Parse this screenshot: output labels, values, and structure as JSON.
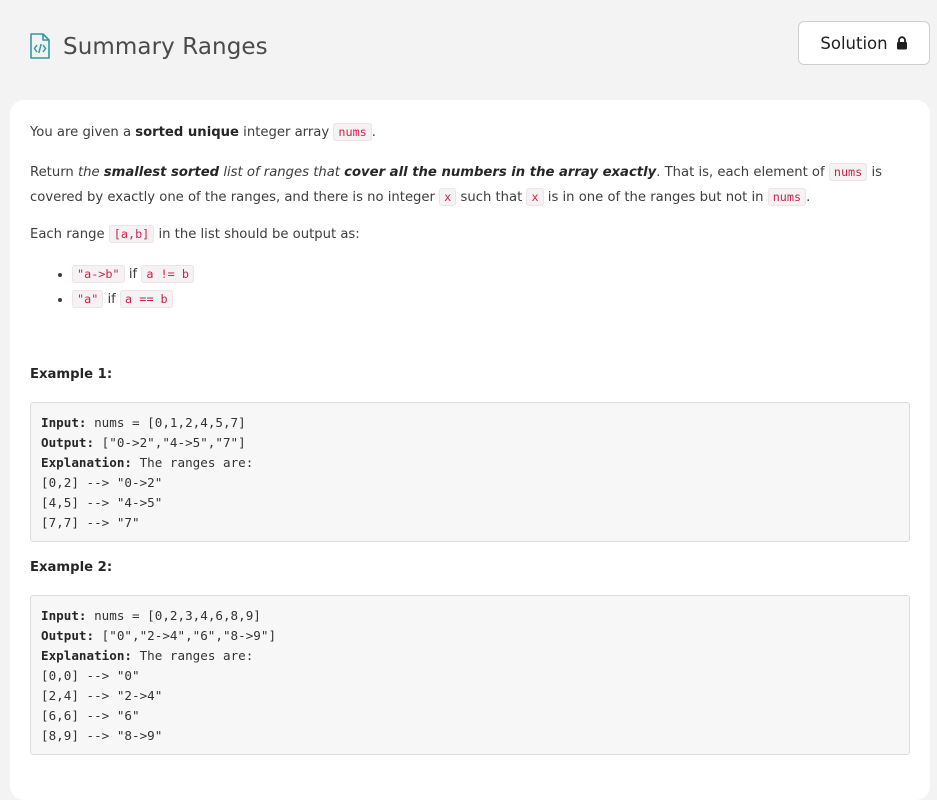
{
  "header": {
    "title": "Summary Ranges",
    "solution_label": "Solution"
  },
  "description": {
    "p1": {
      "t1": "You are given a ",
      "b1": "sorted unique",
      "t2": " integer array ",
      "c1": "nums",
      "t3": "."
    },
    "p2": {
      "t1": "Return ",
      "i1": "the ",
      "bi1": "smallest sorted",
      "i2": " list of ranges that ",
      "bi2": "cover all the numbers in the array exactly",
      "t2": ". That is, each element of ",
      "c1": "nums",
      "t3": " is covered by exactly one of the ranges, and there is no integer ",
      "c2": "x",
      "t4": " such that ",
      "c3": "x",
      "t5": " is in one of the ranges but not in ",
      "c4": "nums",
      "t6": "."
    },
    "p3": {
      "t1": "Each range ",
      "c1": "[a,b]",
      "t2": " in the list should be output as:"
    },
    "bullets": [
      {
        "code1": "\"a->b\"",
        "text": " if ",
        "code2": "a != b"
      },
      {
        "code1": "\"a\"",
        "text": " if ",
        "code2": "a == b"
      }
    ]
  },
  "examples": [
    {
      "title": "Example 1:",
      "input_label": "Input:",
      "input_value": " nums = [0,1,2,4,5,7]",
      "output_label": "Output:",
      "output_value": " [\"0->2\",\"4->5\",\"7\"]",
      "explanation_label": "Explanation:",
      "explanation_value": " The ranges are:",
      "lines": [
        "[0,2] --> \"0->2\"",
        "[4,5] --> \"4->5\"",
        "[7,7] --> \"7\""
      ]
    },
    {
      "title": "Example 2:",
      "input_label": "Input:",
      "input_value": " nums = [0,2,3,4,6,8,9]",
      "output_label": "Output:",
      "output_value": " [\"0\",\"2->4\",\"6\",\"8->9\"]",
      "explanation_label": "Explanation:",
      "explanation_value": " The ranges are:",
      "lines": [
        "[0,0] --> \"0\"",
        "[2,4] --> \"2->4\"",
        "[6,6] --> \"6\"",
        "[8,9] --> \"8->9\""
      ]
    }
  ],
  "icons": {
    "title_icon": "code-document-icon",
    "solution_icon": "lock-icon"
  },
  "colors": {
    "icon_teal": "#2e9c9c",
    "code_text": "#c7254e",
    "background": "#f3f3f3"
  }
}
